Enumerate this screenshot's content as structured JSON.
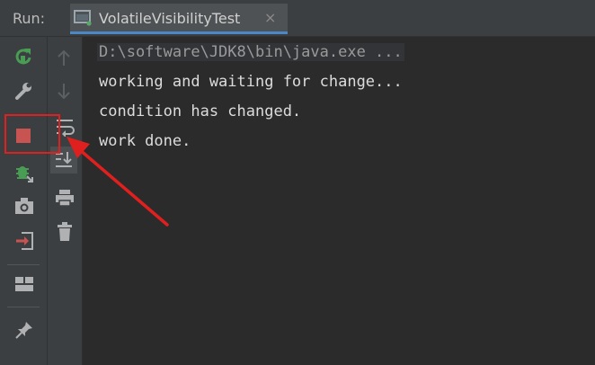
{
  "header": {
    "run_label": "Run:",
    "tab_title": "VolatileVisibilityTest",
    "tab_close": "×"
  },
  "left_toolbar": {
    "buttons": [
      "rerun-icon",
      "wrench-icon",
      "stop-icon",
      "debug-icon",
      "camera-icon",
      "exit-icon",
      "layout-icon",
      "pin-icon"
    ]
  },
  "secondary_toolbar": {
    "buttons": [
      "up-arrow-icon",
      "down-arrow-icon",
      "soft-wrap-icon",
      "scroll-to-end-icon",
      "print-icon",
      "trash-icon"
    ]
  },
  "console": {
    "lines": [
      "D:\\software\\JDK8\\bin\\java.exe ...",
      "working and waiting for change...",
      "condition has changed.",
      "work done."
    ]
  },
  "colors": {
    "annotation_red": "#e0201e",
    "stop_red": "#c75450",
    "rerun_green": "#499c54",
    "tab_accent": "#4a88c7"
  }
}
